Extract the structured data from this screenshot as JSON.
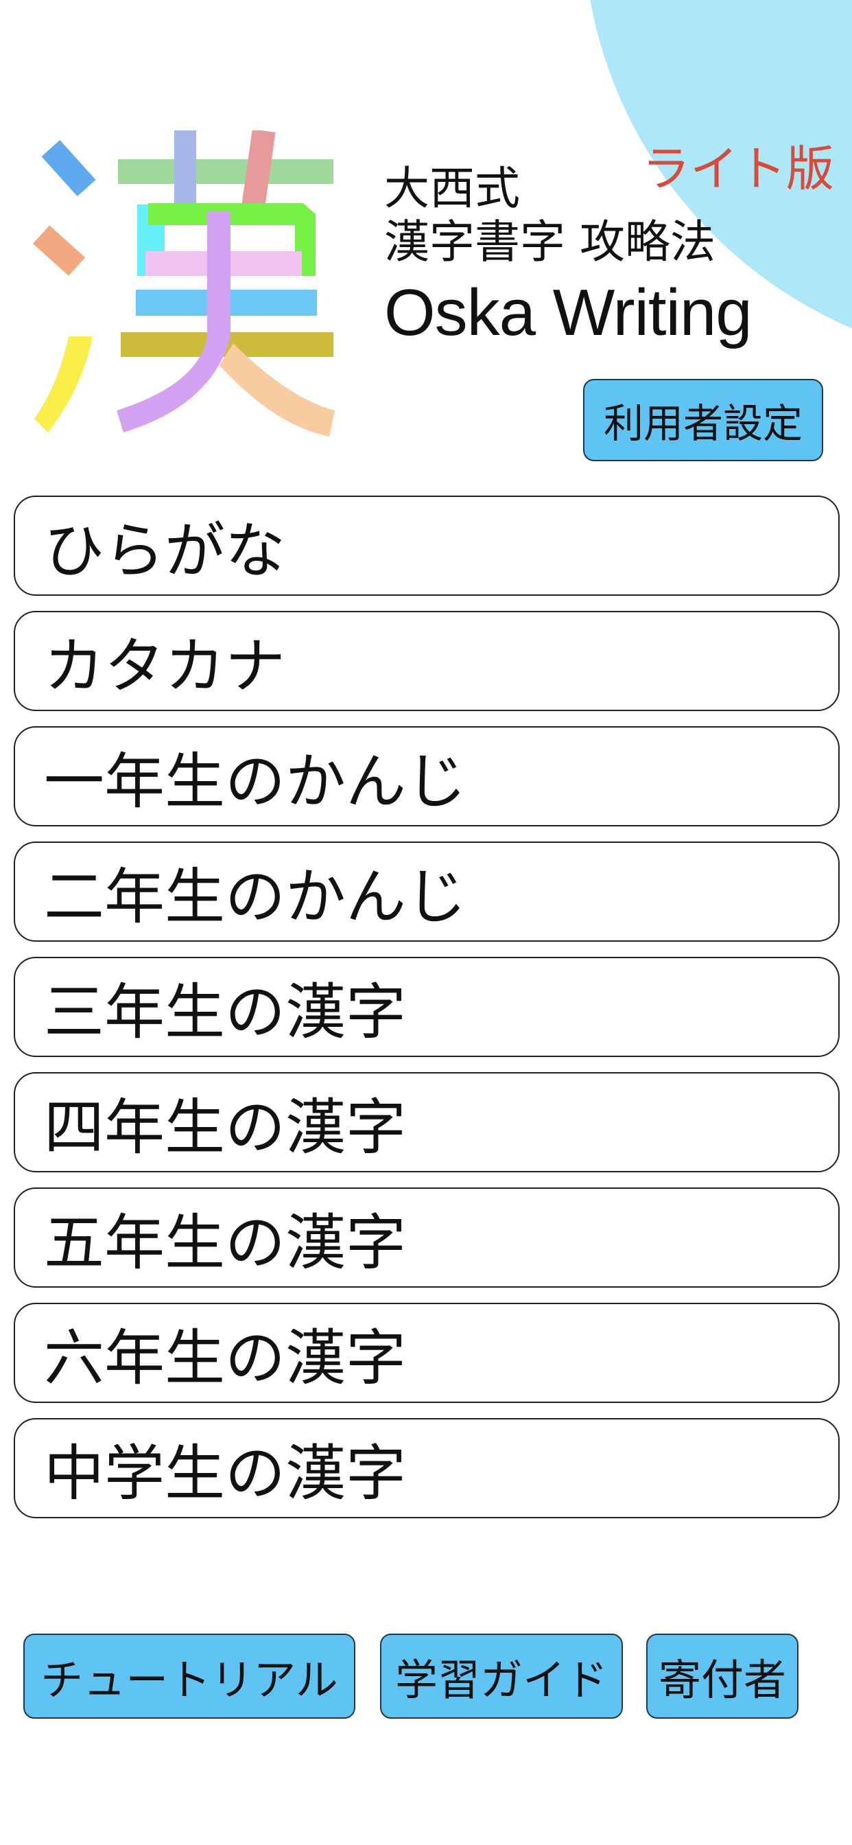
{
  "header": {
    "lite_label": "ライト版",
    "title_line1": "大西式",
    "title_line2": "漢字書字 攻略法",
    "title_line3": "Oska Writing",
    "user_settings_label": "利用者設定",
    "logo_icon": "kanji-stroke-logo-icon"
  },
  "menu": {
    "items": [
      {
        "label": "ひらがな"
      },
      {
        "label": "カタカナ"
      },
      {
        "label": "一年生のかんじ"
      },
      {
        "label": "二年生のかんじ"
      },
      {
        "label": "三年生の漢字"
      },
      {
        "label": "四年生の漢字"
      },
      {
        "label": "五年生の漢字"
      },
      {
        "label": "六年生の漢字"
      },
      {
        "label": "中学生の漢字"
      }
    ]
  },
  "footer": {
    "tutorial_label": "チュートリアル",
    "guide_label": "学習ガイド",
    "donors_label": "寄付者"
  },
  "colors": {
    "button_blue": "#5fc4f4",
    "lite_circle": "#aee8f8",
    "lite_text": "#d84a3a"
  }
}
